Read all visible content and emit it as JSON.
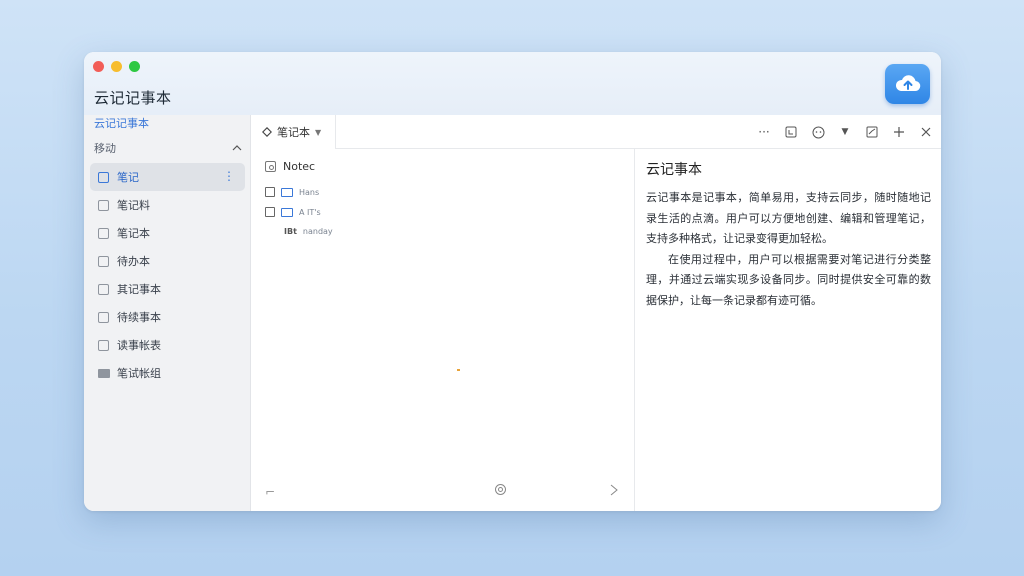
{
  "window": {
    "title": "云记记事本"
  },
  "sidebar": {
    "brand_label": "云记记事本",
    "section_label": "移动",
    "items": [
      {
        "label": "笔记",
        "active": true,
        "icon": "checkbox-icon"
      },
      {
        "label": "笔记料",
        "active": false,
        "icon": "checkbox-icon"
      },
      {
        "label": "笔记本",
        "active": false,
        "icon": "checkbox-icon"
      },
      {
        "label": "待办本",
        "active": false,
        "icon": "checkbox-icon"
      },
      {
        "label": "其记事本",
        "active": false,
        "icon": "checkbox-icon"
      },
      {
        "label": "待续事本",
        "active": false,
        "icon": "checkbox-icon"
      },
      {
        "label": "读事帐表",
        "active": false,
        "icon": "checkbox-icon"
      },
      {
        "label": "笔试帐组",
        "active": false,
        "icon": "folder-icon"
      }
    ]
  },
  "toolbar": {
    "tab_label": "笔记本",
    "icons": [
      "more-icon",
      "format-icon",
      "emoji-icon",
      "dropdown-icon",
      "edit-icon",
      "add-icon",
      "close-icon"
    ]
  },
  "list": {
    "header": "Notec",
    "rows": [
      {
        "tag": "",
        "text": "Hans"
      },
      {
        "tag": "",
        "text": "A IT's"
      },
      {
        "tag": "IBt",
        "text": "nanday"
      }
    ]
  },
  "detail": {
    "title": "云记事本",
    "para1": "云记事本是记事本，简单易用，支持云同步，随时随地记录生活的点滴。用户可以方便地创建、编辑和管理笔记，支持多种格式，让记录变得更加轻松。",
    "para2": "在使用过程中，用户可以根据需要对笔记进行分类整理，并通过云端实现多设备同步。同时提供安全可靠的数据保护，让每一条记录都有迹可循。"
  },
  "colors": {
    "accent": "#3b78d8",
    "cloud_button": "#2f86e6",
    "active_item_bg": "#dfe2e7"
  }
}
